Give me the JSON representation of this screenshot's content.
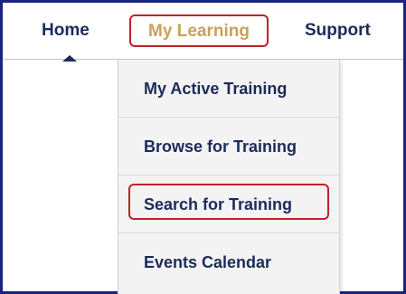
{
  "nav": {
    "items": [
      {
        "label": "Home"
      },
      {
        "label": "My Learning"
      },
      {
        "label": "Support"
      }
    ]
  },
  "dropdown": {
    "items": [
      {
        "label": "My Active Training"
      },
      {
        "label": "Browse for Training"
      },
      {
        "label": "Search for Training"
      },
      {
        "label": "Events Calendar"
      }
    ]
  },
  "colors": {
    "nav_text": "#1c2b5a",
    "active_nav_text": "#c9a15a",
    "highlight_border": "#c0202b",
    "frame_border": "#1a237e",
    "dropdown_bg": "#f3f3f3"
  }
}
